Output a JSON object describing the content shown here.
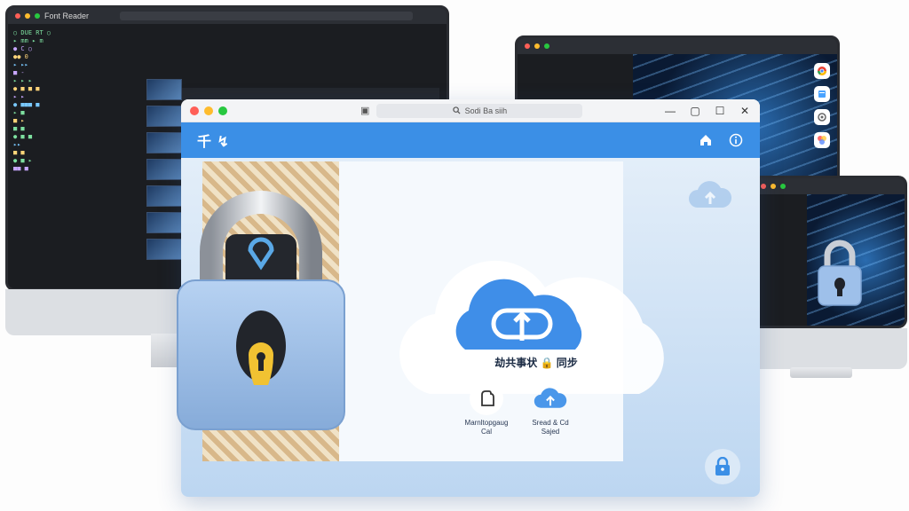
{
  "left_monitor": {
    "app_title": "Font Reader",
    "code_lines": [
      "  ○ DUE RT ○ ",
      "   ▸ mm ▸ m",
      "  ● C ○ ",
      "  ●● 0 ",
      "   ▸ ▸▸ ",
      "   ■ -",
      "   ▸ ▸ ▸ ",
      "  ● ■ ■ ■ ",
      "   ▸ ▸ ",
      "  ● ■■■ ■ ",
      "   ▸ ■ ",
      "  ■ ▸ ",
      "  ■ ■ ",
      "  ● ■ ■ ",
      "   ▸▸ ",
      "  ■ ■ ",
      "  ● ■ ▸ ",
      "   ■■ ■ "
    ]
  },
  "window": {
    "urlbar_text": "Sodi Ba siih",
    "app_title": "千 ↯",
    "cloud_caption": "劫共事状 🔒 同步",
    "features": [
      {
        "label_line1": "Marnltopgaug",
        "label_line2": "Cal"
      },
      {
        "label_line1": "Sread & Cd",
        "label_line2": "Sajed"
      }
    ]
  },
  "icons": {
    "home": "home-icon",
    "info": "info-icon",
    "lock": "lock-icon",
    "cloud": "cloud-icon",
    "search": "search-icon"
  },
  "colors": {
    "appbar": "#3b8fe6",
    "cloud_blue": "#3f8ee8",
    "lock_body": "#9ec0ea",
    "keyhole": "#f1c232"
  }
}
